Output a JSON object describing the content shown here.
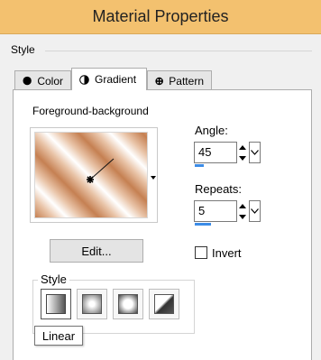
{
  "window": {
    "title": "Material Properties"
  },
  "style_group_label": "Style",
  "tabs": [
    {
      "label": "Color",
      "icon": "filled-circle-icon"
    },
    {
      "label": "Gradient",
      "icon": "half-circle-icon",
      "active": true
    },
    {
      "label": "Pattern",
      "icon": "pattern-circle-icon"
    }
  ],
  "gradient": {
    "name": "Foreground-background",
    "colors": {
      "dark": "#c58052",
      "mid": "#e9c4a8",
      "light": "#ffffff"
    }
  },
  "angle": {
    "label": "Angle:",
    "value": "45"
  },
  "repeats": {
    "label": "Repeats:",
    "value": "5"
  },
  "edit_button": "Edit...",
  "invert": {
    "label": "Invert",
    "checked": false
  },
  "style_section": {
    "label": "Style",
    "options": [
      {
        "name": "linear",
        "selected": true
      },
      {
        "name": "rectangular"
      },
      {
        "name": "sunburst"
      },
      {
        "name": "radial"
      }
    ]
  },
  "tooltip": "Linear",
  "accent_color": "#3c8ce7",
  "titlebar_color": "#f3c16f"
}
